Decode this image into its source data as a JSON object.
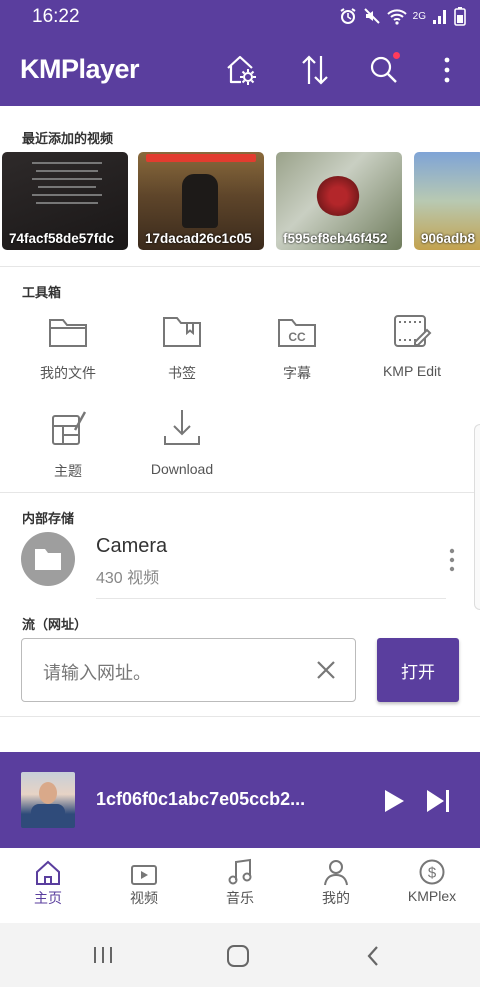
{
  "status_bar": {
    "time": "16:22",
    "network": "2G"
  },
  "app_bar": {
    "title": "KMPlayer"
  },
  "recent": {
    "label": "最近添加的视频",
    "items": [
      {
        "caption": "74facf58de57fdc"
      },
      {
        "caption": "17dacad26c1c05"
      },
      {
        "caption": "f595ef8eb46f452"
      },
      {
        "caption": "906adb8"
      }
    ]
  },
  "toolbox": {
    "label": "工具箱",
    "items": [
      {
        "label": "我的文件",
        "icon": "folder-icon"
      },
      {
        "label": "书签",
        "icon": "bookmark-icon"
      },
      {
        "label": "字幕",
        "icon": "subtitle-icon"
      },
      {
        "label": "KMP Edit",
        "icon": "edit-icon"
      },
      {
        "label": "主题",
        "icon": "theme-icon"
      },
      {
        "label": "Download",
        "icon": "download-icon"
      }
    ]
  },
  "storage": {
    "label": "内部存储",
    "folder_name": "Camera",
    "folder_count": "430 视频"
  },
  "stream": {
    "label": "流（网址）",
    "placeholder": "请输入网址。",
    "open_label": "打开"
  },
  "miniplayer": {
    "title": "1cf06f0c1abc7e05ccb2..."
  },
  "bottom_nav": [
    {
      "label": "主页",
      "icon": "home-icon",
      "active": true
    },
    {
      "label": "视频",
      "icon": "video-icon",
      "active": false
    },
    {
      "label": "音乐",
      "icon": "music-icon",
      "active": false
    },
    {
      "label": "我的",
      "icon": "person-icon",
      "active": false
    },
    {
      "label": "KMPlex",
      "icon": "dollar-circle-icon",
      "active": false
    }
  ],
  "colors": {
    "accent": "#5a3e9e",
    "badge": "#ff3b5c"
  }
}
